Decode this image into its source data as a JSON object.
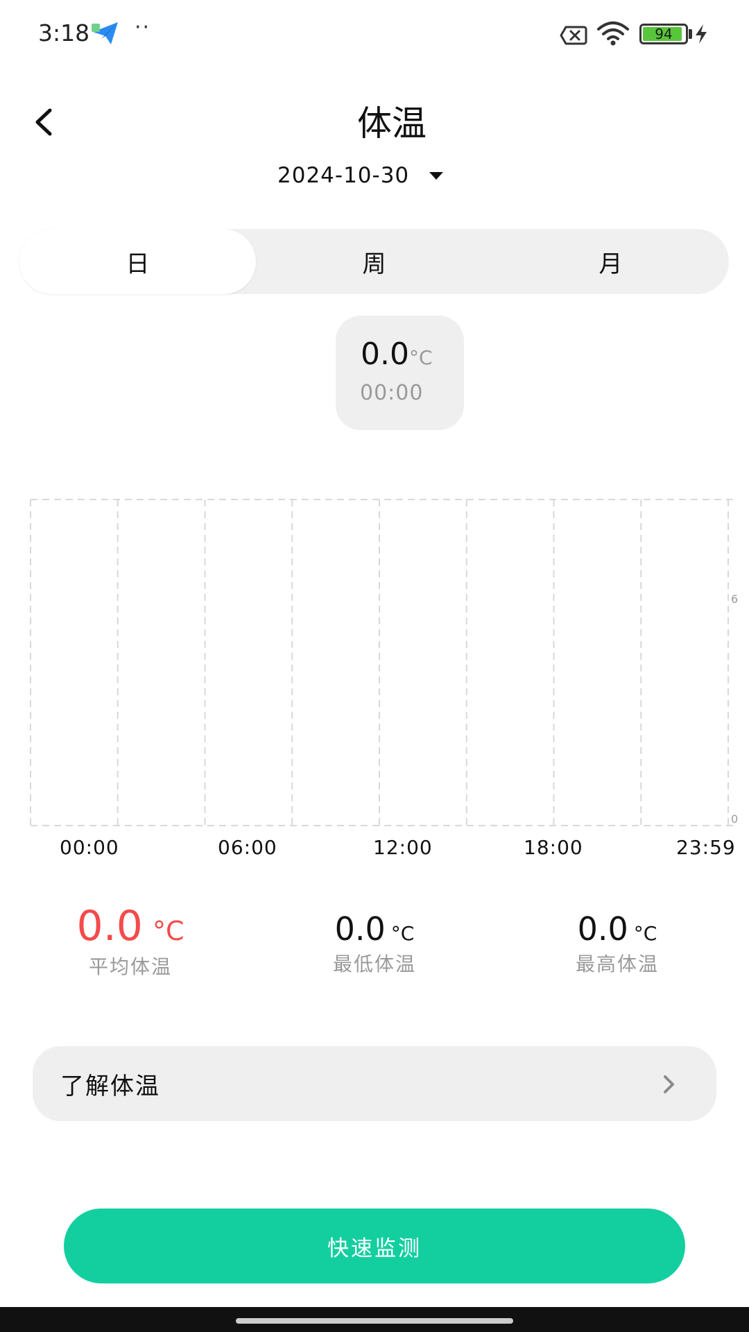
{
  "status_bar": {
    "time": "3:18",
    "dots": "··",
    "battery_level": 94,
    "battery_text": "94",
    "app_icon": "paper-plane-icon",
    "icons": [
      "sim-off-icon",
      "wifi-icon",
      "battery-icon",
      "charging-icon"
    ]
  },
  "header": {
    "title": "体温",
    "date": "2024-10-30",
    "back_icon": "chevron-left-icon",
    "date_dropdown_icon": "caret-down-icon"
  },
  "tabs": [
    {
      "label": "日",
      "active": true
    },
    {
      "label": "周",
      "active": false
    },
    {
      "label": "月",
      "active": false
    }
  ],
  "tooltip": {
    "value": "0.0",
    "unit": "°C",
    "time": "00:00"
  },
  "chart_data": {
    "type": "line",
    "x_ticks": [
      "00:00",
      "06:00",
      "12:00",
      "18:00",
      "23:59"
    ],
    "y_ticks": [
      "6",
      "0"
    ],
    "ylim": [
      0,
      6
    ],
    "grid": true,
    "series": []
  },
  "stats": [
    {
      "value": "0.0",
      "unit": "°C",
      "label": "平均体温",
      "highlight": true
    },
    {
      "value": "0.0",
      "unit": "°C",
      "label": "最低体温",
      "highlight": false
    },
    {
      "value": "0.0",
      "unit": "°C",
      "label": "最高体温",
      "highlight": false
    }
  ],
  "info_row": {
    "label": "了解体温",
    "icon": "chevron-right-icon"
  },
  "primary_button": {
    "label": "快速监测"
  },
  "colors": {
    "accent": "#13cfa0",
    "highlight": "#f44b4b",
    "muted": "#9a9a9a",
    "card_bg": "#efefef",
    "grid": "#d8d8d8"
  }
}
